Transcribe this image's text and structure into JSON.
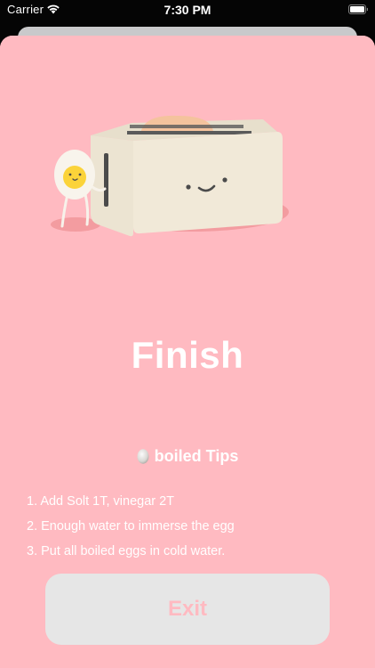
{
  "status_bar": {
    "carrier": "Carrier",
    "time": "7:30 PM",
    "wifi_icon": "wifi-icon",
    "battery_icon": "battery-icon"
  },
  "illustration": {
    "description_icon": "toaster-and-egg-illustration"
  },
  "title": "Finish",
  "tips": {
    "heading": "boiled Tips",
    "icon": "egg-icon",
    "items": [
      "1. Add Solt 1T, vinegar 2T",
      "2. Enough water to immerse the egg",
      "3. Put all boiled eggs in cold water."
    ]
  },
  "exit_button": {
    "label": "Exit"
  },
  "colors": {
    "background_pink": "#ffbac1",
    "button_gray": "#e6e6e6",
    "toaster_cream": "#efe8da",
    "toaster_shadow": "#f29ea2",
    "bread": "#f4c39d"
  }
}
